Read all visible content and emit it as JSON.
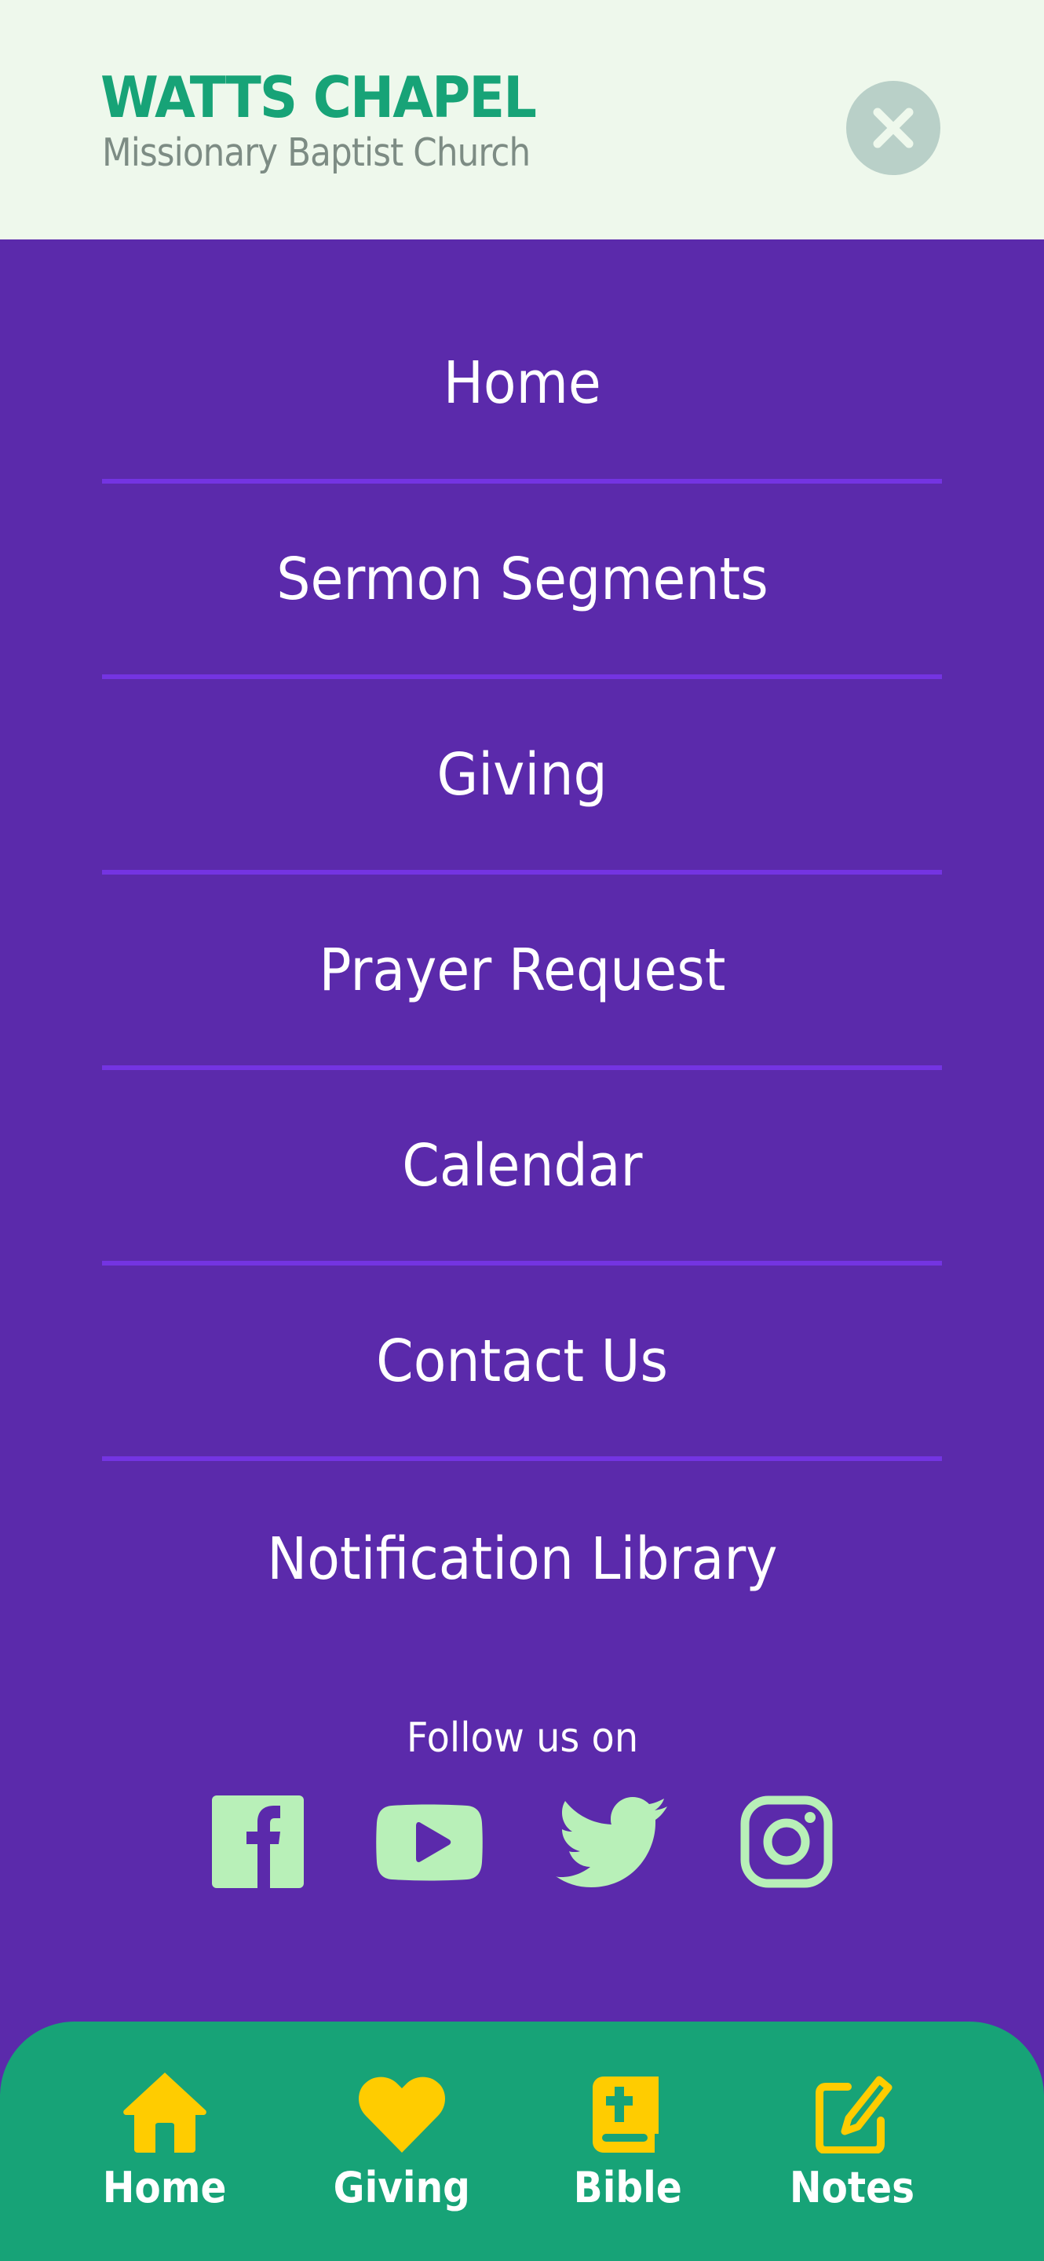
{
  "header": {
    "title": "WATTS CHAPEL",
    "subtitle": "Missionary Baptist Church",
    "close_icon": "close-icon"
  },
  "menu": {
    "items": [
      {
        "label": "Home"
      },
      {
        "label": "Sermon Segments"
      },
      {
        "label": "Giving"
      },
      {
        "label": "Prayer Request"
      },
      {
        "label": "Calendar"
      },
      {
        "label": "Contact Us"
      },
      {
        "label": "Notification Library"
      }
    ]
  },
  "social": {
    "heading": "Follow us on",
    "links": [
      {
        "name": "Facebook",
        "icon": "facebook-icon"
      },
      {
        "name": "YouTube",
        "icon": "youtube-icon"
      },
      {
        "name": "Twitter",
        "icon": "twitter-icon"
      },
      {
        "name": "Instagram",
        "icon": "instagram-icon"
      }
    ]
  },
  "bottom_nav": {
    "items": [
      {
        "label": "Home",
        "icon": "home-icon"
      },
      {
        "label": "Giving",
        "icon": "heart-icon"
      },
      {
        "label": "Bible",
        "icon": "bible-icon"
      },
      {
        "label": "Notes",
        "icon": "notes-icon"
      }
    ]
  },
  "colors": {
    "header_bg": "#eef8ec",
    "brand_green": "#17a377",
    "menu_bg": "#5b2aab",
    "divider": "#7434e2",
    "social_icon": "#b8f0b8",
    "nav_icon": "#ffcc00",
    "close_bg": "#b9d0c8"
  }
}
